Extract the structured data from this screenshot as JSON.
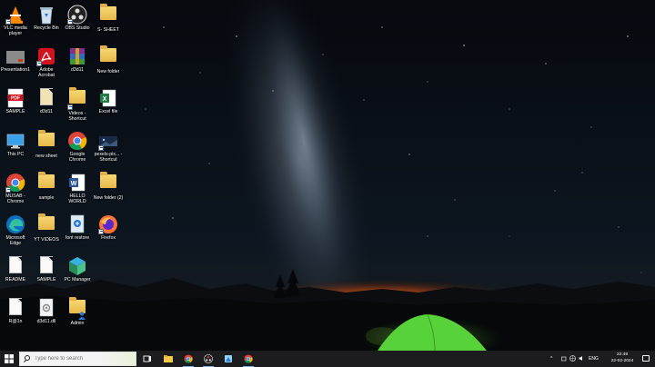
{
  "desktop": {
    "icons": [
      {
        "label": "VLC media player",
        "icon": "vlc-icon"
      },
      {
        "label": "Recycle Bin",
        "icon": "recycle-bin-icon"
      },
      {
        "label": "OBS Studio",
        "icon": "obs-icon"
      },
      {
        "label": "S- SHEET",
        "icon": "folder-icon"
      },
      {
        "label": "Presentation1",
        "icon": "powerpoint-icon"
      },
      {
        "label": "Adobe Acrobat",
        "icon": "acrobat-icon"
      },
      {
        "label": "d3d11",
        "icon": "winrar-icon"
      },
      {
        "label": "New folder",
        "icon": "folder-icon"
      },
      {
        "label": "SAMPLE",
        "icon": "pdf-icon"
      },
      {
        "label": "d3d11",
        "icon": "file-icon"
      },
      {
        "label": "Videos - Shortcut",
        "icon": "folder-shortcut-icon"
      },
      {
        "label": "Excel file",
        "icon": "excel-icon"
      },
      {
        "label": "This PC",
        "icon": "this-pc-icon"
      },
      {
        "label": "new sheet",
        "icon": "folder-icon"
      },
      {
        "label": "Google Chrome",
        "icon": "chrome-icon"
      },
      {
        "label": "pexels-pix... - Shortcut",
        "icon": "image-shortcut-icon"
      },
      {
        "label": "MUSAB - Chrome",
        "icon": "chrome-icon"
      },
      {
        "label": "sample",
        "icon": "folder-icon"
      },
      {
        "label": "HELLO WORLD",
        "icon": "word-icon"
      },
      {
        "label": "New folder (2)",
        "icon": "folder-icon"
      },
      {
        "label": "Microsoft Edge",
        "icon": "edge-icon"
      },
      {
        "label": "YT VIDEOS",
        "icon": "folder-icon"
      },
      {
        "label": "font restore",
        "icon": "font-file-icon"
      },
      {
        "label": "Firefox",
        "icon": "firefox-icon"
      },
      {
        "label": "README",
        "icon": "text-file-icon"
      },
      {
        "label": "SAMPLE",
        "icon": "text-file-icon"
      },
      {
        "label": "PC Manager",
        "icon": "pc-manager-icon"
      },
      {
        "label": "R@1n",
        "icon": "text-file-icon"
      },
      {
        "label": "d3d11.dll",
        "icon": "dll-file-icon"
      },
      {
        "label": "Admin",
        "icon": "user-folder-icon"
      }
    ]
  },
  "taskbar": {
    "search_placeholder": "Type here to search",
    "apps": [
      "task-view-icon",
      "file-explorer-icon",
      "chrome-icon",
      "obs-icon",
      "paint-icon",
      "chrome-icon"
    ],
    "tray": {
      "language": "ENG",
      "time": "22:49",
      "date": "22-02-2024"
    }
  },
  "colors": {
    "taskbar": "#1c1c1e",
    "tent": "#58d23a",
    "horizon_glow": "#ff6a14"
  }
}
